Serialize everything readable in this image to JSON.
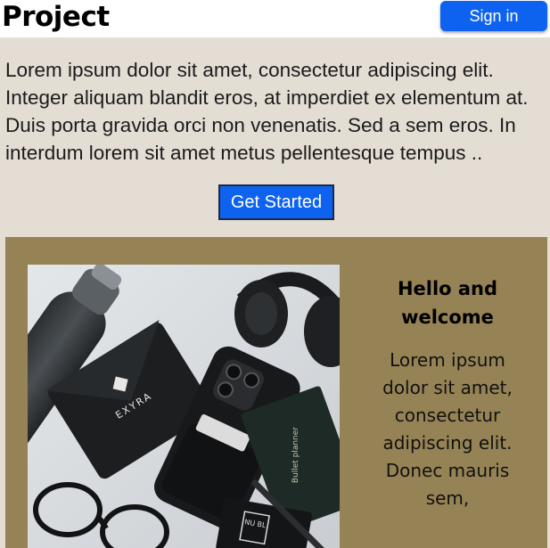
{
  "header": {
    "brand": "Project",
    "signin_label": "Sign in"
  },
  "intro": {
    "text": "Lorem ipsum dolor sit amet, consectetur adipiscing elit. Integer aliquam blandit eros, at imperdiet ex elementum at. Duis porta gravida orci non venenatis. Sed a sem eros. In interdum lorem sit amet metus pellentesque tempus ..",
    "cta_label": "Get Started"
  },
  "feature": {
    "title": "Hello and welcome",
    "body": "Lorem ipsum dolor sit amet, consectetur adipiscing elit. Donec mauris sem,",
    "photo": {
      "wallet_brand": "EXYRA",
      "notebook_text": "Bullet planner",
      "card_text": "NU BL"
    }
  },
  "colors": {
    "header_bg": "#ffffff",
    "page_bg": "#e4ddd4",
    "accent": "#0d63f0",
    "feature_bg": "#968355"
  }
}
